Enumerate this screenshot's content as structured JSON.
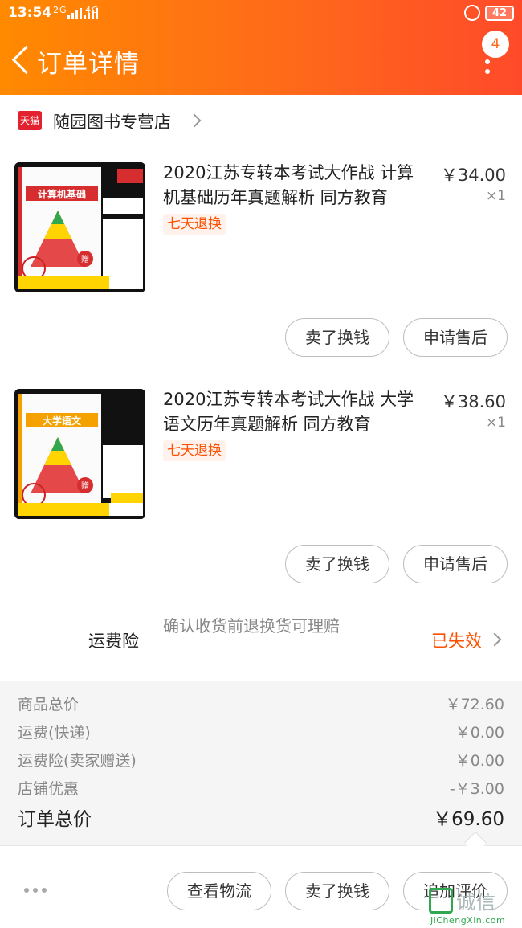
{
  "status_bar": {
    "time": "13:54",
    "network_1": "2G",
    "network_2": "4G",
    "battery": "42"
  },
  "header": {
    "title": "订单详情",
    "badge_count": "4"
  },
  "shop": {
    "logo_text": "天猫",
    "name": "随园图书专营店"
  },
  "products": [
    {
      "title": "2020江苏专转本考试大作战 计算机基础历年真题解析 同方教育",
      "tag": "七天退换",
      "price": "￥34.00",
      "quantity": "×1",
      "cover_colors": [
        "#d62e2e",
        "#ffd400"
      ],
      "buttons": [
        "卖了换钱",
        "申请售后"
      ]
    },
    {
      "title": "2020江苏专转本考试大作战 大学语文历年真题解析 同方教育",
      "tag": "七天退换",
      "price": "￥38.60",
      "quantity": "×1",
      "cover_colors": [
        "#f5a100",
        "#ffd400"
      ],
      "buttons": [
        "卖了换钱",
        "申请售后"
      ]
    }
  ],
  "insurance": {
    "label": "运费险",
    "description": "确认收货前退换货可理赔",
    "status": "已失效"
  },
  "summary": {
    "rows": [
      {
        "label": "商品总价",
        "value": "￥72.60"
      },
      {
        "label": "运费(快递)",
        "value": "￥0.00"
      },
      {
        "label": "运费险(卖家赠送)",
        "value": "￥0.00"
      },
      {
        "label": "店铺优惠",
        "value": "-￥3.00"
      }
    ],
    "total_label": "订单总价",
    "total_value": "￥69.60"
  },
  "bottom_bar": {
    "buttons": [
      "查看物流",
      "卖了换钱",
      "追加评价"
    ]
  },
  "watermark": {
    "cn": "诚信",
    "en": "JiChengXin.com"
  },
  "colors": {
    "header_start": "#ff8a00",
    "header_end": "#ff4a2a",
    "accent": "#ff5000",
    "tmall_red": "#e4212e"
  }
}
